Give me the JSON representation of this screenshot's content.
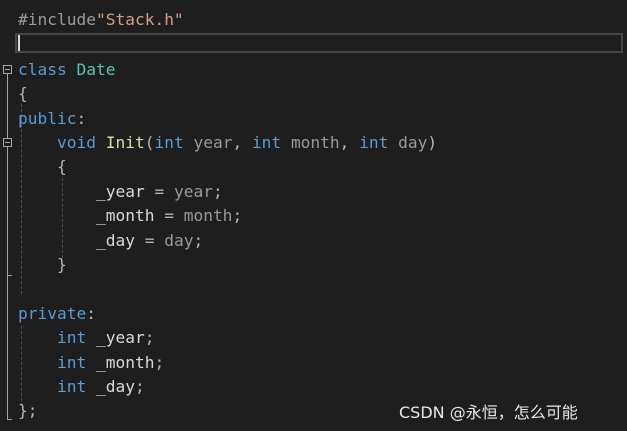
{
  "editor": {
    "lines": [
      {
        "tokens": [
          {
            "t": "#include",
            "c": "prep"
          },
          {
            "t": "\"Stack.h\"",
            "c": "str"
          }
        ]
      },
      {
        "tokens": []
      },
      {
        "tokens": [
          {
            "t": "class",
            "c": "kw"
          },
          {
            "t": " ",
            "c": "punc"
          },
          {
            "t": "Date",
            "c": "type"
          }
        ]
      },
      {
        "tokens": [
          {
            "t": "{",
            "c": "punc"
          }
        ]
      },
      {
        "tokens": [
          {
            "t": "public",
            "c": "kw"
          },
          {
            "t": ":",
            "c": "punc"
          }
        ]
      },
      {
        "tokens": [
          {
            "t": "    ",
            "c": "punc"
          },
          {
            "t": "void",
            "c": "kw"
          },
          {
            "t": " ",
            "c": "punc"
          },
          {
            "t": "Init",
            "c": "fn"
          },
          {
            "t": "(",
            "c": "punc"
          },
          {
            "t": "int",
            "c": "kw"
          },
          {
            "t": " ",
            "c": "punc"
          },
          {
            "t": "year",
            "c": "param"
          },
          {
            "t": ", ",
            "c": "punc"
          },
          {
            "t": "int",
            "c": "kw"
          },
          {
            "t": " ",
            "c": "punc"
          },
          {
            "t": "month",
            "c": "param"
          },
          {
            "t": ", ",
            "c": "punc"
          },
          {
            "t": "int",
            "c": "kw"
          },
          {
            "t": " ",
            "c": "punc"
          },
          {
            "t": "day",
            "c": "param"
          },
          {
            "t": ")",
            "c": "punc"
          }
        ]
      },
      {
        "tokens": [
          {
            "t": "    {",
            "c": "punc"
          }
        ]
      },
      {
        "tokens": [
          {
            "t": "        ",
            "c": "punc"
          },
          {
            "t": "_year",
            "c": "mem"
          },
          {
            "t": " = ",
            "c": "punc"
          },
          {
            "t": "year",
            "c": "param"
          },
          {
            "t": ";",
            "c": "punc"
          }
        ]
      },
      {
        "tokens": [
          {
            "t": "        ",
            "c": "punc"
          },
          {
            "t": "_month",
            "c": "mem"
          },
          {
            "t": " = ",
            "c": "punc"
          },
          {
            "t": "month",
            "c": "param"
          },
          {
            "t": ";",
            "c": "punc"
          }
        ]
      },
      {
        "tokens": [
          {
            "t": "        ",
            "c": "punc"
          },
          {
            "t": "_day",
            "c": "mem"
          },
          {
            "t": " = ",
            "c": "punc"
          },
          {
            "t": "day",
            "c": "param"
          },
          {
            "t": ";",
            "c": "punc"
          }
        ]
      },
      {
        "tokens": [
          {
            "t": "    }",
            "c": "punc"
          }
        ]
      },
      {
        "tokens": []
      },
      {
        "tokens": [
          {
            "t": "private",
            "c": "kw"
          },
          {
            "t": ":",
            "c": "punc"
          }
        ]
      },
      {
        "tokens": [
          {
            "t": "    ",
            "c": "punc"
          },
          {
            "t": "int",
            "c": "kw"
          },
          {
            "t": " ",
            "c": "punc"
          },
          {
            "t": "_year",
            "c": "mem"
          },
          {
            "t": ";",
            "c": "punc"
          }
        ]
      },
      {
        "tokens": [
          {
            "t": "    ",
            "c": "punc"
          },
          {
            "t": "int",
            "c": "kw"
          },
          {
            "t": " ",
            "c": "punc"
          },
          {
            "t": "_month",
            "c": "mem"
          },
          {
            "t": ";",
            "c": "punc"
          }
        ]
      },
      {
        "tokens": [
          {
            "t": "    ",
            "c": "punc"
          },
          {
            "t": "int",
            "c": "kw"
          },
          {
            "t": " ",
            "c": "punc"
          },
          {
            "t": "_day",
            "c": "mem"
          },
          {
            "t": ";",
            "c": "punc"
          }
        ]
      },
      {
        "tokens": [
          {
            "t": "};",
            "c": "punc"
          }
        ]
      }
    ],
    "fold_markers": [
      "collapse-icon",
      "collapse-icon"
    ],
    "colors": {
      "background": "#1e1e1e",
      "keyword": "#569cd6",
      "type": "#4ec9b0",
      "function": "#dcdcaa",
      "string": "#d69d85",
      "preprocessor": "#9b9b9b"
    }
  },
  "watermark": {
    "text": "CSDN @永恒，怎么可能"
  }
}
